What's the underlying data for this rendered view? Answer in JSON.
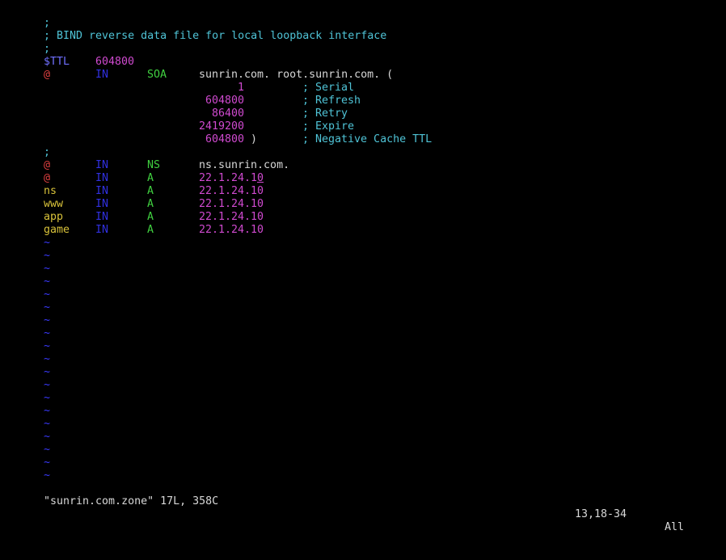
{
  "colors": {
    "comment": "#4fc3d6",
    "directive": "#7070ff",
    "number": "#d04ad0",
    "at": "#e04040",
    "class": "#3030e0",
    "type": "#40d040",
    "name": "#d8c23a",
    "plain": "#d8d8d8",
    "tilde": "#3a3aff"
  },
  "editor": {
    "lines": [
      [
        {
          "t": ";",
          "c": "comment",
          "col": 0
        }
      ],
      [
        {
          "t": "; BIND reverse data file for local loopback interface",
          "c": "comment",
          "col": 0
        }
      ],
      [
        {
          "t": ";",
          "c": "comment",
          "col": 0
        }
      ],
      [
        {
          "t": "$TTL",
          "c": "directive",
          "col": 0
        },
        {
          "t": "604800",
          "c": "number",
          "col": 8
        }
      ],
      [
        {
          "t": "@",
          "c": "at",
          "col": 0
        },
        {
          "t": "IN",
          "c": "class",
          "col": 8
        },
        {
          "t": "SOA",
          "c": "type",
          "col": 16
        },
        {
          "t": "sunrin.com. root.sunrin.com. (",
          "c": "plain",
          "col": 24
        }
      ],
      [
        {
          "t": "1",
          "c": "number",
          "col": 30
        },
        {
          "t": "; Serial",
          "c": "comment",
          "col": 40
        }
      ],
      [
        {
          "t": "604800",
          "c": "number",
          "col": 25
        },
        {
          "t": "; Refresh",
          "c": "comment",
          "col": 40
        }
      ],
      [
        {
          "t": "86400",
          "c": "number",
          "col": 26
        },
        {
          "t": "; Retry",
          "c": "comment",
          "col": 40
        }
      ],
      [
        {
          "t": "2419200",
          "c": "number",
          "col": 24
        },
        {
          "t": "; Expire",
          "c": "comment",
          "col": 40
        }
      ],
      [
        {
          "t": "604800",
          "c": "number",
          "col": 25
        },
        {
          "t": ")",
          "c": "plain",
          "col": 32
        },
        {
          "t": "; Negative Cache TTL",
          "c": "comment",
          "col": 40
        }
      ],
      [
        {
          "t": ";",
          "c": "comment",
          "col": 0
        }
      ],
      [
        {
          "t": "@",
          "c": "at",
          "col": 0
        },
        {
          "t": "IN",
          "c": "class",
          "col": 8
        },
        {
          "t": "NS",
          "c": "type",
          "col": 16
        },
        {
          "t": "ns.sunrin.com.",
          "c": "plain",
          "col": 24
        }
      ],
      [
        {
          "t": "@",
          "c": "at",
          "col": 0
        },
        {
          "t": "IN",
          "c": "class",
          "col": 8
        },
        {
          "t": "A",
          "c": "type",
          "col": 16
        },
        {
          "t": "22.1.24.1",
          "c": "number",
          "col": 24
        },
        {
          "t": "0",
          "c": "number",
          "col": 33,
          "cursor": true
        }
      ],
      [
        {
          "t": "ns",
          "c": "name",
          "col": 0
        },
        {
          "t": "IN",
          "c": "class",
          "col": 8
        },
        {
          "t": "A",
          "c": "type",
          "col": 16
        },
        {
          "t": "22.1.24.10",
          "c": "number",
          "col": 24
        }
      ],
      [
        {
          "t": "www",
          "c": "name",
          "col": 0
        },
        {
          "t": "IN",
          "c": "class",
          "col": 8
        },
        {
          "t": "A",
          "c": "type",
          "col": 16
        },
        {
          "t": "22.1.24.10",
          "c": "number",
          "col": 24
        }
      ],
      [
        {
          "t": "app",
          "c": "name",
          "col": 0
        },
        {
          "t": "IN",
          "c": "class",
          "col": 8
        },
        {
          "t": "A",
          "c": "type",
          "col": 16
        },
        {
          "t": "22.1.24.10",
          "c": "number",
          "col": 24
        }
      ],
      [
        {
          "t": "game",
          "c": "name",
          "col": 0
        },
        {
          "t": "IN",
          "c": "class",
          "col": 8
        },
        {
          "t": "A",
          "c": "type",
          "col": 16
        },
        {
          "t": "22.1.24.10",
          "c": "number",
          "col": 24
        }
      ]
    ],
    "tilde_char": "~",
    "tilde_lines": 19
  },
  "status": {
    "file_info": "\"sunrin.com.zone\" 17L, 358C",
    "position": "13,18-34",
    "scroll": "All"
  }
}
